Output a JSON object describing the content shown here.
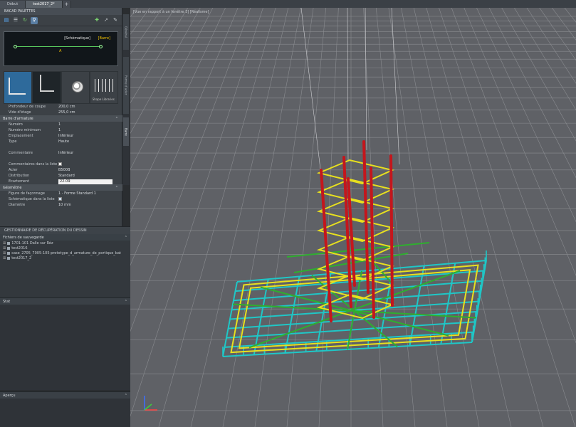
{
  "doc_tabs": [
    {
      "label": "Début",
      "active": false
    },
    {
      "label": "test2017_2*",
      "active": true
    },
    {
      "label": "+",
      "active": false
    }
  ],
  "palette": {
    "title": "BACAD PALETTES",
    "preview": {
      "mode": "[Schématique]",
      "layer": "[Barre]",
      "mark": "A"
    },
    "type_label": "Shape Libraries",
    "side_tabs": [
      "Général",
      "Forme d'acier",
      "Barre"
    ],
    "pre_rows": [
      {
        "name": "Profondeur de coupe",
        "value": "200,0 cm"
      },
      {
        "name": "Vide d'étage",
        "value": "255,0 cm"
      }
    ],
    "sections": [
      {
        "title": "Barre d'armature",
        "rows": [
          {
            "name": "Numéro",
            "value": "1"
          },
          {
            "name": "Numéro minimum",
            "value": "1"
          },
          {
            "name": "Emplacement",
            "value": "Inférieur"
          },
          {
            "name": "Type",
            "value": "Haute"
          },
          {
            "name": "",
            "value": ""
          },
          {
            "name": "Commentaire",
            "value": "Inférieur"
          },
          {
            "name": "",
            "value": ""
          },
          {
            "name": "Commentaires dans la liste",
            "value": "",
            "check": true
          },
          {
            "name": "Acier",
            "value": "B500B"
          },
          {
            "name": "Distribution",
            "value": "Standard"
          },
          {
            "name": "Ecartement",
            "value": "22-09",
            "input": true
          }
        ]
      },
      {
        "title": "Géométrie",
        "rows": [
          {
            "name": "Figure de façonnage",
            "value": "1 - Forme Standard 1"
          },
          {
            "name": "Schématique dans la liste",
            "value": "",
            "check": true
          },
          {
            "name": "Diamètre",
            "value": "10 mm"
          }
        ]
      }
    ]
  },
  "recovery": {
    "title": "GESTIONNAIRE DE RÉCUPÉRATION DU DESSIN",
    "group": "Fichiers de sauvegarde",
    "items": [
      "1701-101 Dalle sur Réz",
      "test2016",
      "case_2705_7005-105-prototype_d_armature_de_portique_bat",
      "test2017_2"
    ]
  },
  "panels": [
    {
      "title": "Stat"
    },
    {
      "title": "Aperçu"
    }
  ],
  "viewport": {
    "label": "[Vue en rapport à un fenêtre 3] [Réalisme]",
    "colors": {
      "background": "#5f6166",
      "grid": "#8a8c90",
      "column_bars": "#c4161c",
      "stirrups": "#e8e01e",
      "slab_bars": "#1fc7c7",
      "diagonals": "#2fae2f"
    }
  },
  "colors": {
    "panel": "#3c4146",
    "accent": "#2e6a9b",
    "preview_line": "#5bd060",
    "preview_label": "#f2c200"
  }
}
